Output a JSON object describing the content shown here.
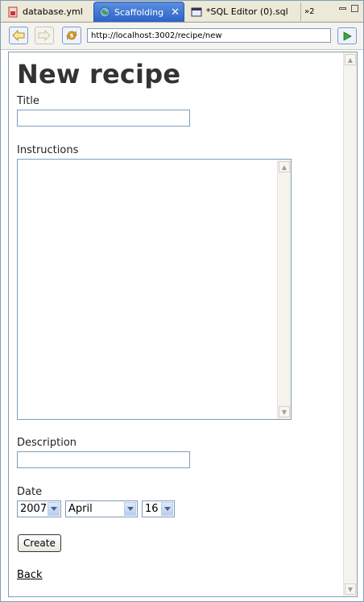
{
  "tabs": [
    {
      "label": "database.yml"
    },
    {
      "label": "Scaffolding",
      "close": "✕"
    },
    {
      "label": "*SQL Editor (0).sql"
    }
  ],
  "tab_overflow": "»2",
  "toolbar": {
    "url": "http://localhost:3002/recipe/new"
  },
  "page": {
    "title": "New recipe",
    "title_label": "Title",
    "instructions_label": "Instructions",
    "description_label": "Description",
    "date_label": "Date",
    "year": "2007",
    "month": "April",
    "day": "16",
    "create_label": "Create",
    "back_label": "Back"
  },
  "colors": {
    "active_tab": "#2c63c8",
    "go_arrow": "#2e9a2e"
  }
}
